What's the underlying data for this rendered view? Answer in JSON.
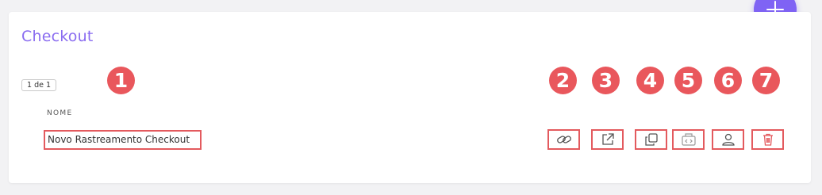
{
  "card": {
    "title": "Checkout",
    "pagination": "1 de 1",
    "column_header": "NOME",
    "rows": [
      {
        "name": "Novo Rastreamento Checkout"
      }
    ]
  },
  "actions": [
    {
      "icon": "link-icon"
    },
    {
      "icon": "external-link-icon"
    },
    {
      "icon": "copy-icon"
    },
    {
      "icon": "code-box-icon"
    },
    {
      "icon": "user-icon"
    },
    {
      "icon": "trash-icon"
    }
  ],
  "annotations": [
    "1",
    "2",
    "3",
    "4",
    "5",
    "6",
    "7"
  ],
  "fab": {
    "icon": "plus-icon"
  },
  "colors": {
    "accent": "#8a6cf0",
    "fab": "#7f63f4",
    "highlight": "#e35a5e",
    "badge": "#e9575c",
    "delete": "#e35a5e",
    "icon": "#555555"
  }
}
